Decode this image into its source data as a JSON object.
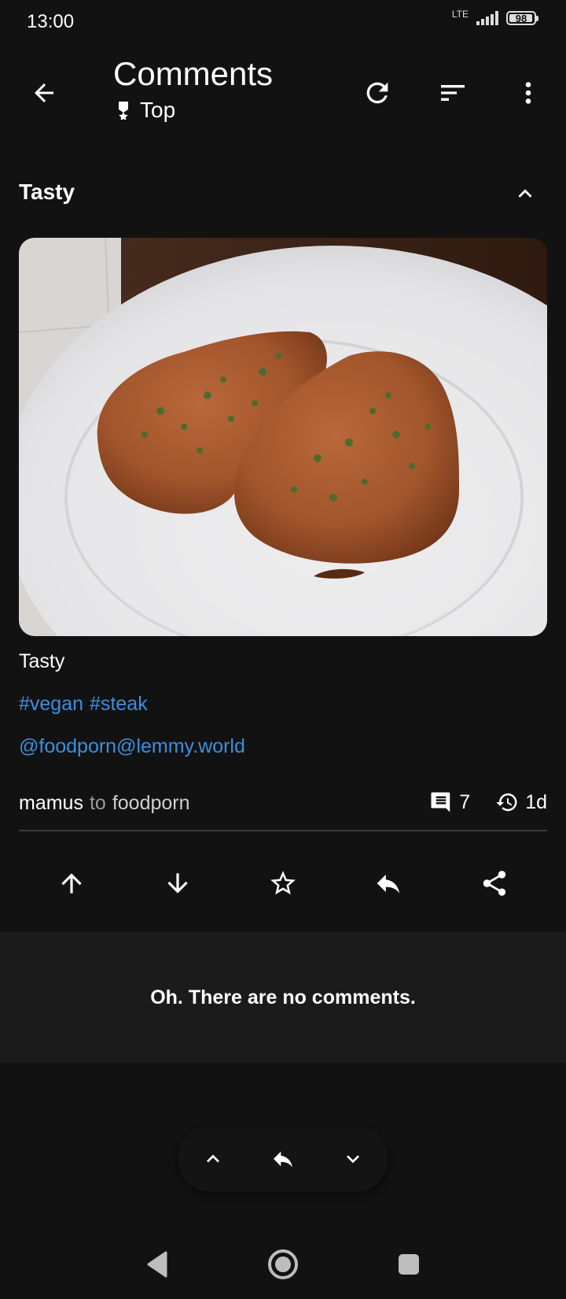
{
  "status": {
    "time": "13:00",
    "network": "LTE",
    "battery": "98",
    "battery_level": 0.98
  },
  "appbar": {
    "title": "Comments",
    "sort_label": "Top"
  },
  "post": {
    "title": "Tasty",
    "body": "Tasty",
    "tags": [
      "#vegan",
      "#steak"
    ],
    "community_link": "@foodporn@lemmy.world",
    "author": "mamus",
    "to_word": "to",
    "community": "foodporn",
    "comment_count": "7",
    "age": "1d"
  },
  "comments": {
    "empty_message": "Oh. There are no comments."
  },
  "colors": {
    "background": "#121212",
    "link": "#3d8fe0",
    "panel": "#1b1b1b"
  },
  "icons": {
    "back": "arrow-back-icon",
    "sort_badge": "medal-icon",
    "refresh": "refresh-icon",
    "sort": "sort-icon",
    "more": "more-vert-icon",
    "collapse": "chevron-up-icon",
    "upvote": "arrow-up-icon",
    "downvote": "arrow-down-icon",
    "save": "star-icon",
    "reply": "reply-icon",
    "share": "share-icon",
    "comments": "comment-icon",
    "time": "history-icon"
  }
}
